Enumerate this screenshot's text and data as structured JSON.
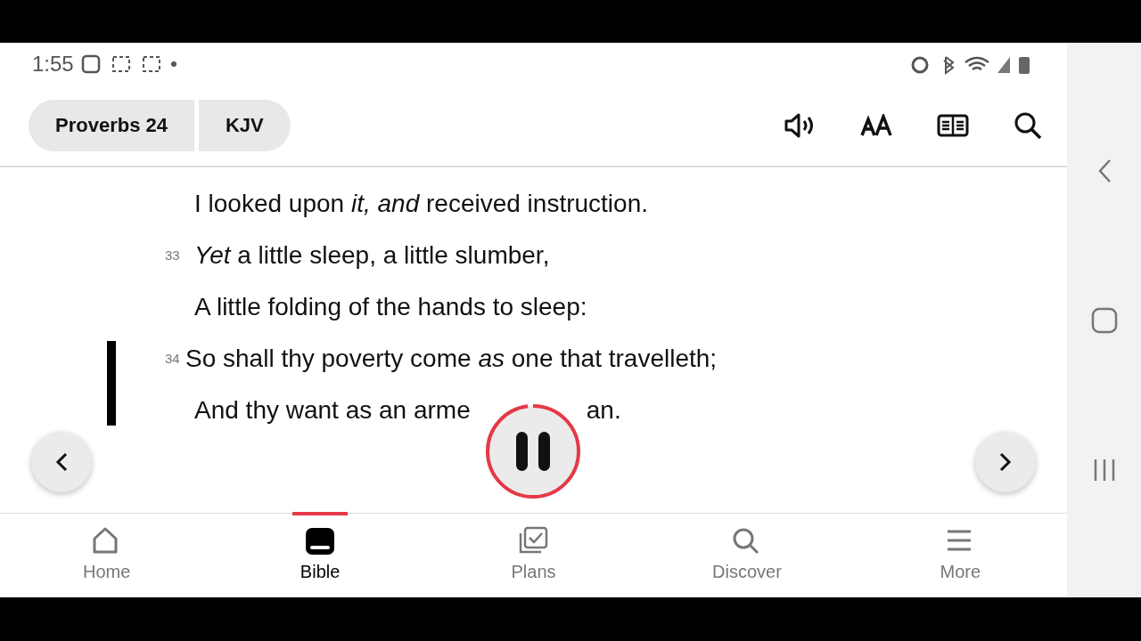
{
  "status_bar": {
    "time": "1:55"
  },
  "header": {
    "chips": [
      {
        "label": "Proverbs 24"
      },
      {
        "label": "KJV"
      }
    ]
  },
  "reader": {
    "lines": [
      {
        "text": "I looked upon *it, and* received instruction."
      },
      {
        "verse": "33",
        "text": "*Yet* a little sleep, a little slumber,"
      },
      {
        "text": "A little folding of the hands to sleep:"
      },
      {
        "verse": "34",
        "text": "So shall thy poverty come *as* one that travelleth;"
      },
      {
        "text": "And thy want as an arme",
        "text_after": "an."
      }
    ]
  },
  "player": {
    "playing": true,
    "level": 0.98
  },
  "bottom_nav": [
    {
      "label": "Home",
      "kind": "home",
      "selected": false
    },
    {
      "label": "Bible",
      "kind": "bible",
      "selected": true
    },
    {
      "label": "Plans",
      "kind": "plans",
      "selected": false
    },
    {
      "label": "Discover",
      "kind": "discover",
      "selected": false
    },
    {
      "label": "More",
      "kind": "more",
      "selected": false
    }
  ]
}
